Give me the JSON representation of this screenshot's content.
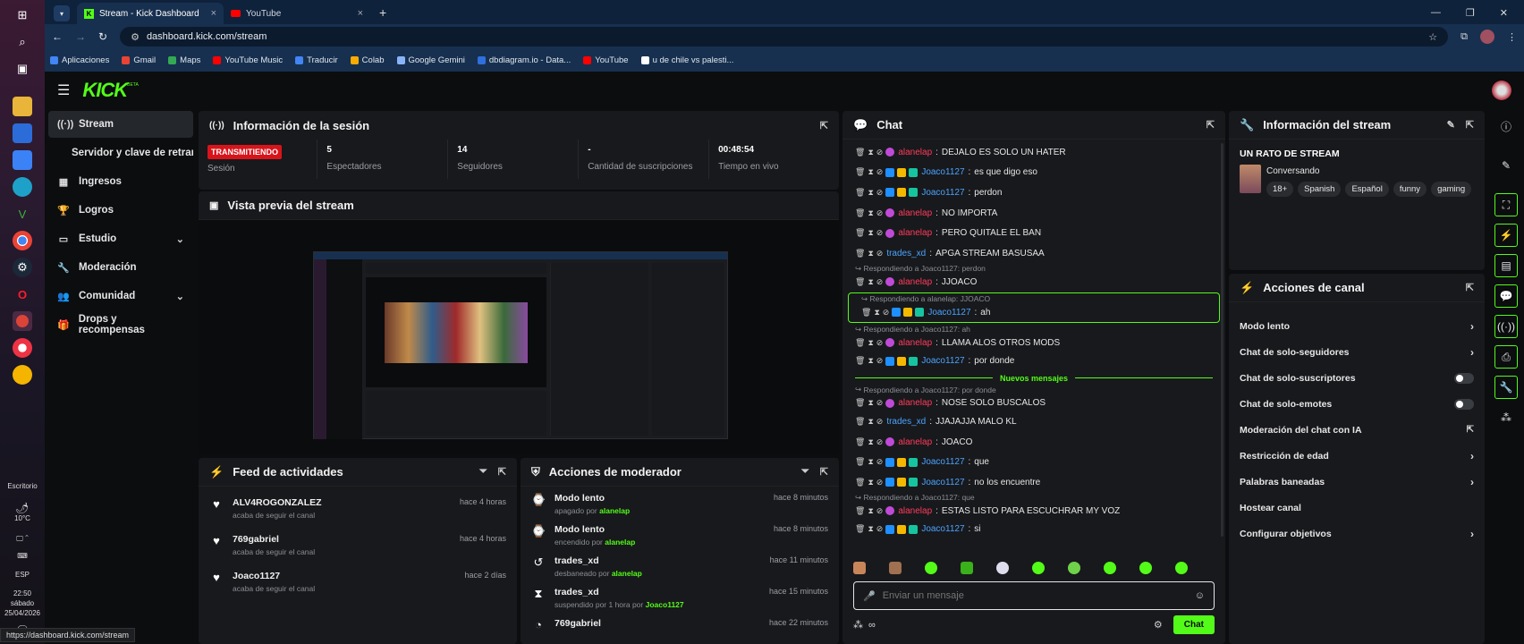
{
  "taskbar": {
    "weather_label": "Escritorio",
    "temperature": "10°C",
    "language": "ESP",
    "time": "22:50",
    "day": "sábado",
    "date": "25/04/2026"
  },
  "browser": {
    "tabs": [
      {
        "label": "Stream - Kick Dashboard"
      },
      {
        "label": "YouTube"
      }
    ],
    "url": "dashboard.kick.com/stream",
    "status_url": "https://dashboard.kick.com/stream",
    "bookmarks": [
      {
        "label": "Aplicaciones",
        "color": "#4285f4"
      },
      {
        "label": "Gmail",
        "color": "#ea4335"
      },
      {
        "label": "Maps",
        "color": "#34a853"
      },
      {
        "label": "YouTube Music",
        "color": "#ff0000"
      },
      {
        "label": "Traducir",
        "color": "#4285f4"
      },
      {
        "label": "Colab",
        "color": "#f9ab00"
      },
      {
        "label": "Google Gemini",
        "color": "#8ab4f8"
      },
      {
        "label": "dbdiagram.io - Data...",
        "color": "#2f6fde"
      },
      {
        "label": "YouTube",
        "color": "#ff0000"
      },
      {
        "label": "u de chile vs palesti...",
        "color": "#ffffff"
      }
    ]
  },
  "kick": {
    "logo": "KICK",
    "beta": "BETA",
    "accent": "#53fc18"
  },
  "sidenav": {
    "items": [
      {
        "label": "Stream",
        "icon": "broadcast-icon",
        "glyph": "((·))"
      },
      {
        "label": "Servidor y clave de retransmisión",
        "icon": "",
        "glyph": ""
      },
      {
        "label": "Ingresos",
        "icon": "revenue-icon",
        "glyph": "▦"
      },
      {
        "label": "Logros",
        "icon": "trophy-icon",
        "glyph": "🏆"
      },
      {
        "label": "Estudio",
        "icon": "studio-icon",
        "glyph": "▭"
      },
      {
        "label": "Moderación",
        "icon": "wrench-icon",
        "glyph": "🔧"
      },
      {
        "label": "Comunidad",
        "icon": "community-icon",
        "glyph": "👥"
      },
      {
        "label": "Drops y recompensas",
        "icon": "gift-icon",
        "glyph": "🎁"
      }
    ]
  },
  "session": {
    "title": "Información de la sesión",
    "status_badge": "TRANSMITIENDO",
    "status_label": "Sesión",
    "stats": [
      {
        "value": "5",
        "label": "Espectadores"
      },
      {
        "value": "14",
        "label": "Seguidores"
      },
      {
        "value": "-",
        "label": "Cantidad de suscripciones"
      },
      {
        "value": "00:48:54",
        "label": "Tiempo en vivo"
      }
    ]
  },
  "preview": {
    "title": "Vista previa del stream"
  },
  "feed": {
    "title": "Feed de actividades",
    "items": [
      {
        "user": "ALV4ROGONZALEZ",
        "desc": "acaba de seguir el canal",
        "time": "hace 4 horas"
      },
      {
        "user": "769gabriel",
        "desc": "acaba de seguir el canal",
        "time": "hace 4 horas"
      },
      {
        "user": "Joaco1127",
        "desc": "acaba de seguir el canal",
        "time": "hace 2 días"
      }
    ]
  },
  "modactions": {
    "title": "Acciones de moderador",
    "items": [
      {
        "action": "Modo lento",
        "desc": "apagado por",
        "by": "alanelap",
        "time": "hace 8 minutos",
        "icon": "slow-mode-icon",
        "glyph": "⌚"
      },
      {
        "action": "Modo lento",
        "desc": "encendido por",
        "by": "alanelap",
        "time": "hace 8 minutos",
        "icon": "slow-mode-icon",
        "glyph": "⌚"
      },
      {
        "action": "trades_xd",
        "desc": "desbaneado por",
        "by": "alanelap",
        "time": "hace 11 minutos",
        "icon": "unban-icon",
        "glyph": "↺"
      },
      {
        "action": "trades_xd",
        "desc": "suspendido por 1 hora por",
        "by": "Joaco1127",
        "time": "hace 15 minutos",
        "icon": "hourglass-icon",
        "glyph": "⧗"
      },
      {
        "action": "769gabriel",
        "desc": "",
        "by": "",
        "time": "hace 22 minutos",
        "icon": "timeout-icon",
        "glyph": "◔"
      }
    ]
  },
  "chat": {
    "title": "Chat",
    "new_messages": "Nuevos mensajes",
    "input_placeholder": "Enviar un mensaje",
    "send_label": "Chat",
    "messages": [
      {
        "reply": "",
        "user": "alanelap",
        "color": "red",
        "text": "DEJALO ES SOLO UN HATER",
        "highlight": false
      },
      {
        "reply": "",
        "user": "Joaco1127",
        "color": "blue",
        "text": "es que digo eso",
        "highlight": false
      },
      {
        "reply": "",
        "user": "Joaco1127",
        "color": "blue",
        "text": "perdon",
        "highlight": false
      },
      {
        "reply": "",
        "user": "alanelap",
        "color": "red",
        "text": "NO IMPORTA",
        "highlight": false
      },
      {
        "reply": "",
        "user": "alanelap",
        "color": "red",
        "text": "PERO QUITALE EL BAN",
        "highlight": false
      },
      {
        "reply": "",
        "user": "trades_xd",
        "color": "blue",
        "text": "APGA STREAM BASUSAA",
        "highlight": false
      },
      {
        "reply": "Respondiendo a Joaco1127: perdon",
        "user": "alanelap",
        "color": "red",
        "text": "JJOACO",
        "highlight": false
      },
      {
        "reply": "Respondiendo a alanelap: JJOACO",
        "user": "Joaco1127",
        "color": "blue",
        "text": "ah",
        "highlight": true
      },
      {
        "reply": "Respondiendo a Joaco1127: ah",
        "user": "alanelap",
        "color": "red",
        "text": "LLAMA ALOS OTROS MODS",
        "highlight": false
      },
      {
        "reply": "",
        "user": "Joaco1127",
        "color": "blue",
        "text": "por donde",
        "highlight": false
      },
      {
        "reply": "Respondiendo a Joaco1127: por donde",
        "user": "alanelap",
        "color": "red",
        "text": "NOSE SOLO BUSCALOS",
        "highlight": false
      },
      {
        "reply": "",
        "user": "trades_xd",
        "color": "blue",
        "text": "JJAJAJJA MALO KL",
        "highlight": false
      },
      {
        "reply": "",
        "user": "alanelap",
        "color": "red",
        "text": "JOACO",
        "highlight": false
      },
      {
        "reply": "",
        "user": "Joaco1127",
        "color": "blue",
        "text": "que",
        "highlight": false
      },
      {
        "reply": "",
        "user": "Joaco1127",
        "color": "blue",
        "text": "no los encuentre",
        "highlight": false
      },
      {
        "reply": "Respondiendo a Joaco1127: que",
        "user": "alanelap",
        "color": "red",
        "text": "ESTAS LISTO PARA ESCUCHRAR MY VOZ",
        "highlight": false
      },
      {
        "reply": "",
        "user": "Joaco1127",
        "color": "blue",
        "text": "si",
        "highlight": false
      }
    ]
  },
  "streaminfo": {
    "title": "Información del stream",
    "stream_title": "UN RATO DE STREAM",
    "category": "Conversando",
    "tags": [
      "18+",
      "Spanish",
      "Español",
      "funny",
      "gaming"
    ]
  },
  "channel": {
    "title": "Acciones de canal",
    "actions": [
      {
        "label": "Modo lento",
        "type": "chevron"
      },
      {
        "label": "Chat de solo-seguidores",
        "type": "chevron"
      },
      {
        "label": "Chat de solo-suscriptores",
        "type": "toggle"
      },
      {
        "label": "Chat de solo-emotes",
        "type": "toggle"
      },
      {
        "label": "Moderación del chat con IA",
        "type": "external"
      },
      {
        "label": "Restricción de edad",
        "type": "chevron"
      },
      {
        "label": "Palabras baneadas",
        "type": "chevron"
      },
      {
        "label": "Hostear canal",
        "type": "none"
      },
      {
        "label": "Configurar objetivos",
        "type": "chevron"
      }
    ]
  }
}
